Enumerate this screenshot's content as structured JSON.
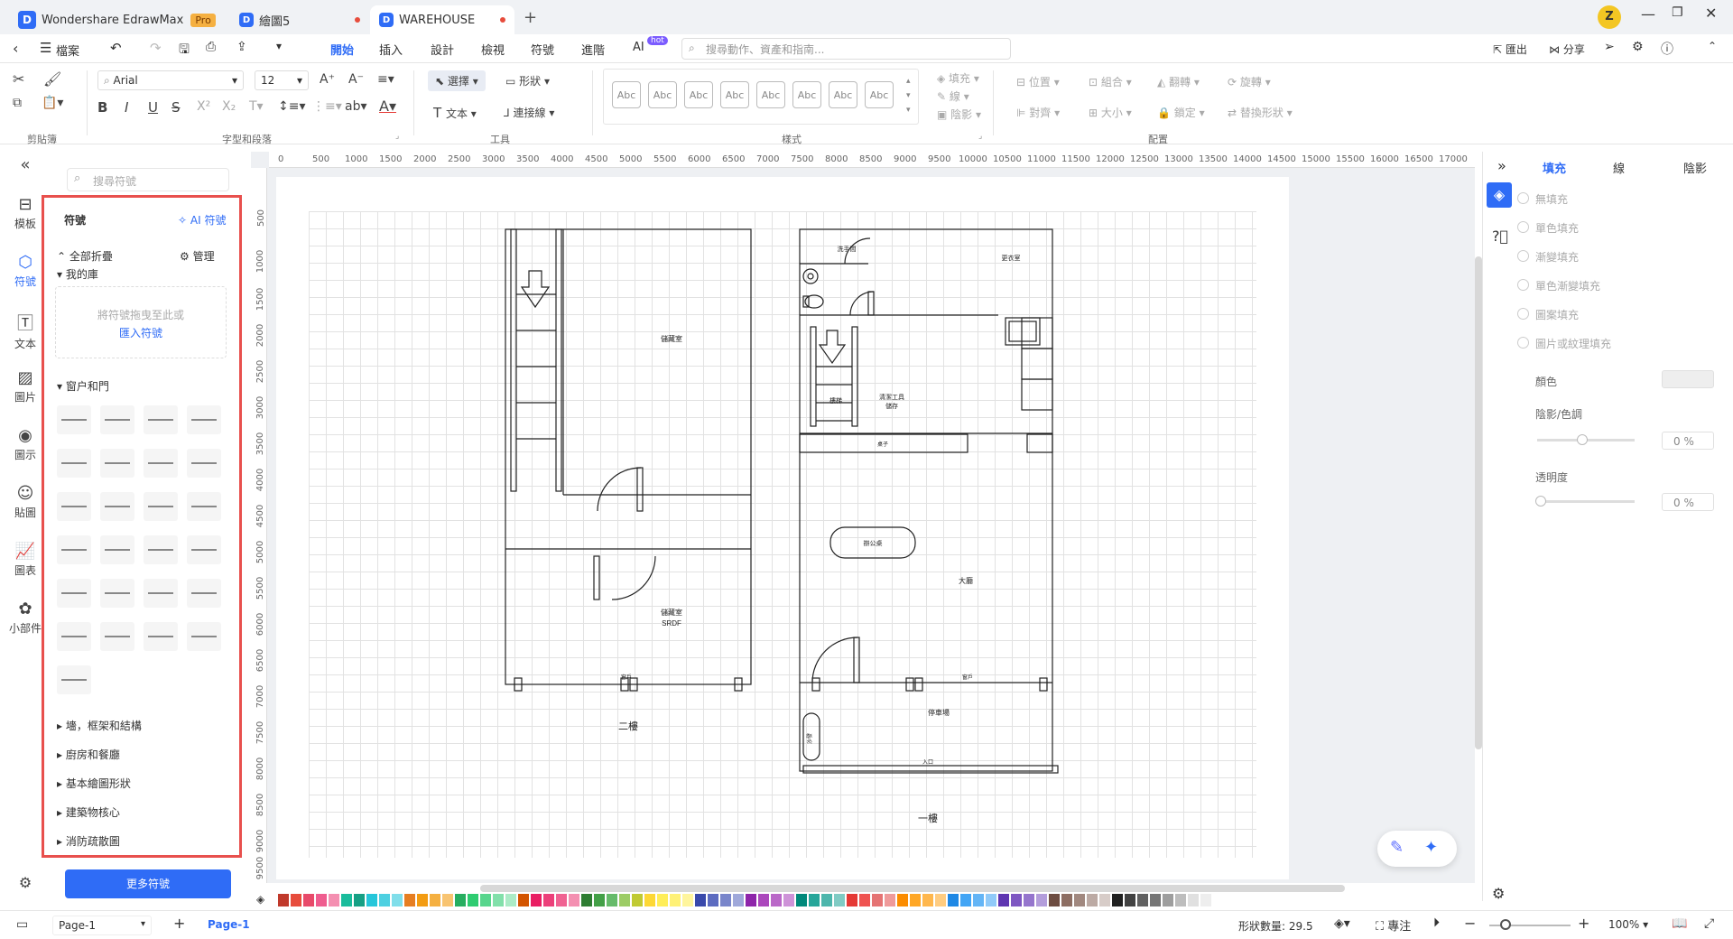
{
  "titlebar": {
    "app_name": "Wondershare EdrawMax",
    "pro_badge": "Pro",
    "tabs": [
      {
        "label": "繪圖5"
      },
      {
        "label": "WAREHOUSE"
      }
    ],
    "avatar": "Z"
  },
  "menubar": {
    "file": "檔案",
    "items": [
      "開始",
      "插入",
      "設計",
      "檢視",
      "符號",
      "進階",
      "AI"
    ],
    "ai_badge": "hot",
    "search_placeholder": "搜尋動作、資產和指南...",
    "export": "匯出",
    "share": "分享"
  },
  "ribbon": {
    "font_name": "Arial",
    "font_size": "12",
    "select": "選擇",
    "shape": "形狀",
    "text": "文本",
    "connector": "連接線",
    "style_swatch": "Abc",
    "fill": "填充",
    "line": "線",
    "shadow": "陰影",
    "position": "位置",
    "group": "組合",
    "flip": "翻轉",
    "rotate": "旋轉",
    "align": "對齊",
    "size": "大小",
    "lock": "鎖定",
    "replace_shape": "替換形狀",
    "groups": [
      "剪貼簿",
      "字型和段落",
      "工具",
      "樣式",
      "配置"
    ]
  },
  "rail": [
    "模板",
    "符號",
    "文本",
    "圖片",
    "圖示",
    "貼圖",
    "圖表",
    "小部件"
  ],
  "panel": {
    "search_placeholder": "搜尋符號",
    "title": "符號",
    "ai_symbol": "AI 符號",
    "collapse_all": "全部折疊",
    "manage": "管理",
    "my_library": "我的庫",
    "drop_hint": "將符號拖曳至此或",
    "import_symbol": "匯入符號",
    "category_open": "窗户和門",
    "categories": [
      "墻，框架和結構",
      "廚房和餐廳",
      "基本繪圖形狀",
      "建築物核心",
      "消防疏散圖"
    ],
    "more_button": "更多符號"
  },
  "ruler": {
    "top": [
      "0",
      "500",
      "1000",
      "1500",
      "2000",
      "2500",
      "3000",
      "3500",
      "4000",
      "4500",
      "5000",
      "5500",
      "6000",
      "6500",
      "7000",
      "7500",
      "8000",
      "8500",
      "9000",
      "9500",
      "10000",
      "10500",
      "11000",
      "11500",
      "12000",
      "12500",
      "13000",
      "13500",
      "14000",
      "14500",
      "15000",
      "15500",
      "16000",
      "16500",
      "17000"
    ],
    "left": [
      "500",
      "1000",
      "1500",
      "2000",
      "2500",
      "3000",
      "3500",
      "4000",
      "4500",
      "5000",
      "5500",
      "6000",
      "6500",
      "7000",
      "7500",
      "8000",
      "8500",
      "9000",
      "9500",
      "3000"
    ]
  },
  "plan": {
    "floor2_label": "二樓",
    "floor1_label": "一樓",
    "room_storage": "儲藏室",
    "room_storage2": "儲藏室",
    "srdf": "SRDF",
    "washroom": "洗手間",
    "lounge": "更衣室",
    "stairs": "樓梯",
    "cleaning_tools": "清潔工具",
    "storage_small": "儲存",
    "table": "桌子",
    "office": "辦公桌",
    "hall": "大廳",
    "parking": "停車場",
    "entrance": "入口",
    "window_label": "窗戶",
    "sofa": "沙發"
  },
  "rpanel": {
    "tabs": [
      "填充",
      "線",
      "陰影"
    ],
    "options": [
      "無填充",
      "單色填充",
      "漸變填充",
      "單色漸變填充",
      "圖案填充",
      "圖片或紋理填充"
    ],
    "color": "顏色",
    "shade": "陰影/色調",
    "shade_value": "0 %",
    "transparency": "透明度",
    "transparency_value": "0 %"
  },
  "colors": [
    "#c0392b",
    "#e74c3c",
    "#e84a6a",
    "#ef5d8f",
    "#f48fb1",
    "#1abc9c",
    "#16a085",
    "#26c6da",
    "#4dd0e1",
    "#80deea",
    "#e67e22",
    "#f39c12",
    "#f5b041",
    "#f8c471",
    "#27ae60",
    "#2ecc71",
    "#58d68d",
    "#82e0aa",
    "#abebc6",
    "#d35400",
    "#e91e63",
    "#ec407a",
    "#f06292",
    "#f48fb1",
    "#2e7d32",
    "#43a047",
    "#66bb6a",
    "#9ccc65",
    "#c0ca33",
    "#fdd835",
    "#ffee58",
    "#fff176",
    "#fff59d",
    "#3949ab",
    "#5c6bc0",
    "#7986cb",
    "#9fa8da",
    "#8e24aa",
    "#ab47bc",
    "#ba68c8",
    "#ce93d8",
    "#00897b",
    "#26a69a",
    "#4db6ac",
    "#80cbc4",
    "#e53935",
    "#ef5350",
    "#e57373",
    "#ef9a9a",
    "#fb8c00",
    "#ffa726",
    "#ffb74d",
    "#ffcc80",
    "#1e88e5",
    "#42a5f5",
    "#64b5f6",
    "#90caf9",
    "#5e35b1",
    "#7e57c2",
    "#9575cd",
    "#b39ddb",
    "#6d4c41",
    "#8d6e63",
    "#a1887f",
    "#bcaaa4",
    "#d7ccc8",
    "#212121",
    "#424242",
    "#616161",
    "#757575",
    "#9e9e9e",
    "#bdbdbd",
    "#e0e0e0",
    "#eeeeee"
  ],
  "status": {
    "page_select": "Page-1",
    "page_tab": "Page-1",
    "shape_count": "形狀數量: 29.5",
    "focus": "專注",
    "zoom": "100%"
  }
}
